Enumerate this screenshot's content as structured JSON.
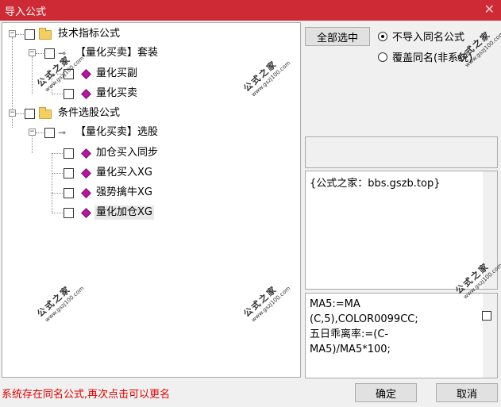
{
  "window": {
    "title": "导入公式"
  },
  "tree": {
    "nodes": [
      {
        "label": "技术指标公式"
      },
      {
        "label": "【量化买卖】套装"
      },
      {
        "label": "量化买副"
      },
      {
        "label": "量化买卖"
      },
      {
        "label": "条件选股公式"
      },
      {
        "label": "【量化买卖】选股"
      },
      {
        "label": "加仓买入同步"
      },
      {
        "label": "量化买入XG"
      },
      {
        "label": "强势擒牛XG"
      },
      {
        "label": "量化加仓XG"
      }
    ]
  },
  "controls": {
    "select_all": "全部选中",
    "option_skip": "不导入同名公式",
    "option_overwrite": "覆盖同名(非系统)"
  },
  "description": {
    "text": "{公式之家：bbs.gszb.top}"
  },
  "code": {
    "lines": [
      "MA5:=MA",
      "(C,5),COLOR0099CC;",
      "五日乖离率:=(C-",
      "MA5)/MA5*100;"
    ]
  },
  "status": {
    "text": "系统存在同名公式,再次点击可以更名"
  },
  "buttons": {
    "ok": "确定",
    "cancel": "取消"
  },
  "watermark": {
    "text": "公式之家",
    "url": "www.gszj100.com"
  },
  "colors": {
    "titlebar": "#cd2a35",
    "status": "#e00000",
    "diamond": "#b5179e",
    "folder": "#f2cf63"
  }
}
